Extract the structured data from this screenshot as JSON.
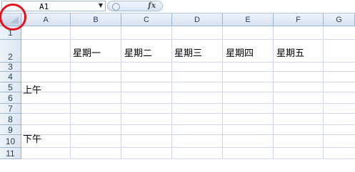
{
  "formula_bar": {
    "name_box": "A1",
    "fx_label": "fx",
    "formula": ""
  },
  "columns": [
    "A",
    "B",
    "C",
    "D",
    "E",
    "F",
    "G"
  ],
  "rows": [
    "1",
    "2",
    "3",
    "4",
    "5",
    "6",
    "7",
    "8",
    "9",
    "10",
    "11"
  ],
  "cells": {
    "B2": "星期一",
    "C2": "星期二",
    "D2": "星期三",
    "E2": "星期四",
    "F2": "星期五",
    "A4": "上午",
    "A8": "下午"
  },
  "colors": {
    "highlight_ring": "#e8101a",
    "header_fill": "#dce6f3",
    "gridline": "#d0d7e5"
  }
}
